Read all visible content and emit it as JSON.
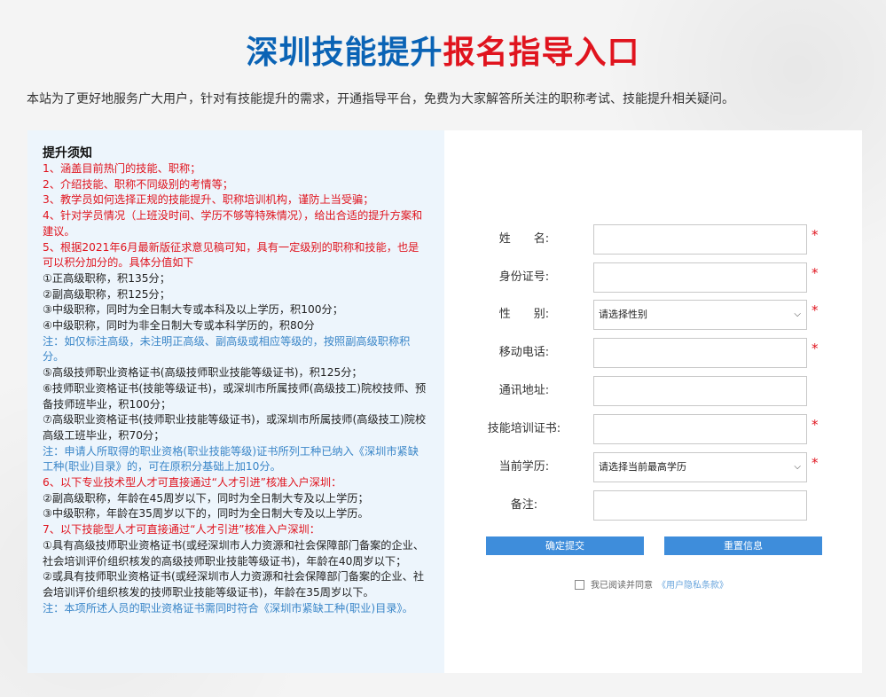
{
  "title": {
    "part1": "深圳技能提升",
    "part2": "报名指导入口"
  },
  "intro": "本站为了更好地服务广大用户，针对有技能提升的需求，开通指导平台，免费为大家解答所关注的职称考试、技能提升相关疑问。",
  "notice": {
    "heading": "提升须知",
    "lines": [
      {
        "color": "red",
        "text": "1、涵盖目前热门的技能、职称；"
      },
      {
        "color": "red",
        "text": "2、介绍技能、职称不同级别的考情等；"
      },
      {
        "color": "red",
        "text": "3、教学员如何选择正规的技能提升、职称培训机构，谨防上当受骗；"
      },
      {
        "color": "red",
        "text": "4、针对学员情况（上班没时间、学历不够等特殊情况），给出合适的提升方案和建议。"
      },
      {
        "color": "red",
        "text": "5、根据2021年6月最新版征求意见稿可知，具有一定级别的职称和技能，也是可以积分加分的。具体分值如下"
      },
      {
        "color": "blk",
        "text": "①正高级职称，积135分；"
      },
      {
        "color": "blk",
        "text": "②副高级职称，积125分；"
      },
      {
        "color": "blk",
        "text": "③中级职称，同时为全日制大专或本科及以上学历，积100分；"
      },
      {
        "color": "blk",
        "text": "④中级职称，同时为非全日制大专或本科学历的，积80分"
      },
      {
        "color": "blue",
        "text": "注：如仅标注高级，未注明正高级、副高级或相应等级的，按照副高级职称积分。"
      },
      {
        "color": "blk",
        "text": "⑤高级技师职业资格证书(高级技师职业技能等级证书)，积125分；"
      },
      {
        "color": "blk",
        "text": "⑥技师职业资格证书(技能等级证书)，或深圳市所属技师(高级技工)院校技师、预备技师班毕业，积100分；"
      },
      {
        "color": "blk",
        "text": "⑦高级职业资格证书(技师职业技能等级证书)，或深圳市所属技师(高级技工)院校高级工班毕业，积70分；"
      },
      {
        "color": "blue",
        "text": "注：申请人所取得的职业资格(职业技能等级)证书所列工种已纳入《深圳市紧缺工种(职业)目录》的，可在原积分基础上加10分。"
      },
      {
        "color": "red",
        "text": "6、以下专业技术型人才可直接通过“人才引进”核准入户深圳："
      },
      {
        "color": "blk",
        "text": "②副高级职称，年龄在45周岁以下，同时为全日制大专及以上学历；"
      },
      {
        "color": "blk",
        "text": "③中级职称，年龄在35周岁以下的，同时为全日制大专及以上学历。"
      },
      {
        "color": "red",
        "text": "7、以下技能型人才可直接通过“人才引进”核准入户深圳："
      },
      {
        "color": "blk",
        "text": "①具有高级技师职业资格证书(或经深圳市人力资源和社会保障部门备案的企业、社会培训评价组织核发的高级技师职业技能等级证书)，年龄在40周岁以下；"
      },
      {
        "color": "blk",
        "text": "②或具有技师职业资格证书(或经深圳市人力资源和社会保障部门备案的企业、社会培训评价组织核发的技师职业技能等级证书)，年龄在35周岁以下。"
      },
      {
        "color": "blue",
        "text": "注：本项所述人员的职业资格证书需同时符合《深圳市紧缺工种(职业)目录》。"
      }
    ]
  },
  "form": {
    "name_label": "姓　　名:",
    "id_label": "身份证号:",
    "gender_label": "性　　别:",
    "gender_selected": "请选择性别",
    "phone_label": "移动电话:",
    "address_label": "通讯地址:",
    "cert_label": "技能培训证书:",
    "edu_label": "当前学历:",
    "edu_selected": "请选择当前最高学历",
    "remark_label": "备注:",
    "required_mark": "*",
    "submit_label": "确定提交",
    "reset_label": "重置信息",
    "agree_text": "我已阅读并同意",
    "agree_link": "《用户隐私条款》"
  },
  "icons": {
    "select_arrow": "chevron-down-icon"
  },
  "colors": {
    "title_blue": "#0a63b5",
    "title_red": "#e0141e",
    "button_blue": "#3e8ddb"
  }
}
